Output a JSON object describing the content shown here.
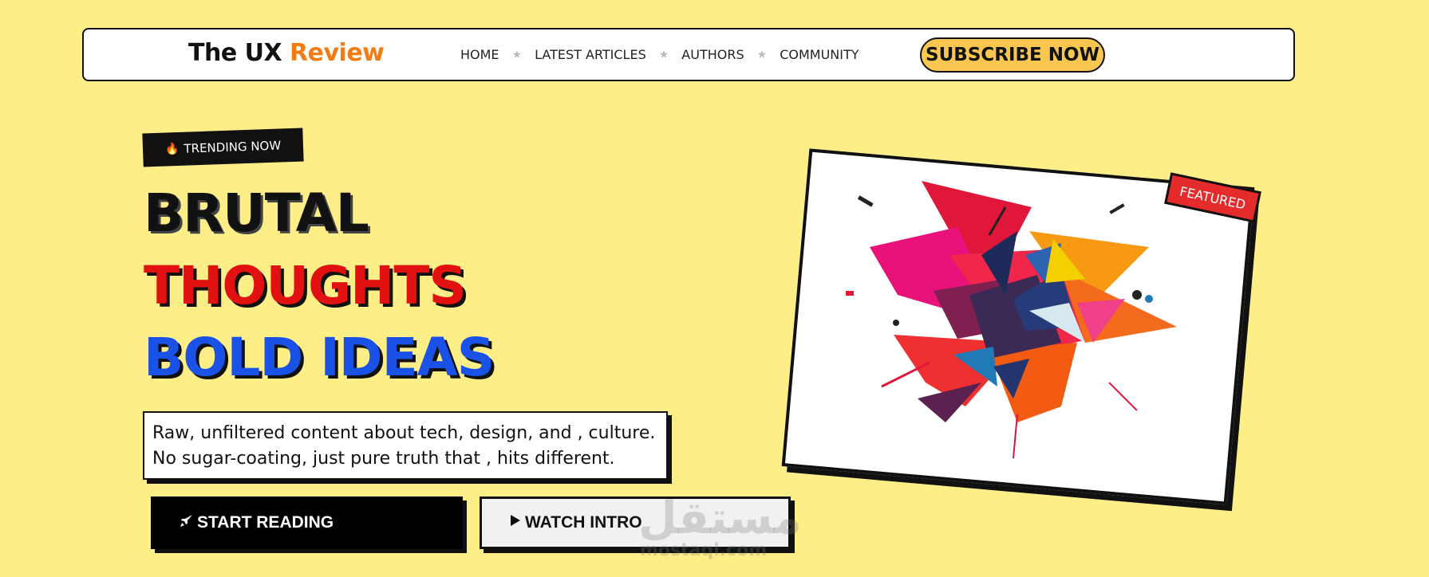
{
  "brand": {
    "name_part1": "The UX ",
    "name_part2": "Review",
    "accent_color": "#f47b12"
  },
  "nav": {
    "links": [
      "HOME",
      "LATEST ARTICLES",
      "AUTHORS",
      "COMMUNITY"
    ],
    "separator": "★",
    "subscribe_label": "SUBSCRIBE NOW"
  },
  "hero": {
    "badge_label": "TRENDING NOW",
    "badge_icon": "flame-icon",
    "headline": [
      "BRUTAL",
      "THOUGHTS",
      "BOLD IDEAS"
    ],
    "headline_colors": [
      "#111111",
      "#e21111",
      "#1a52e8"
    ],
    "description_line1": "Raw, unfiltered content about tech, design, and , culture.",
    "description_line2": "No sugar-coating, just pure truth that , hits different.",
    "start_button": {
      "icon": "rocket-icon",
      "label": "START READING"
    },
    "watch_button": {
      "icon": "play-icon",
      "label": "WATCH INTRO"
    }
  },
  "featured_card": {
    "tag_label": "FEATURED"
  },
  "watermark": {
    "text": "مستقل",
    "sub": "mostaql.com"
  }
}
